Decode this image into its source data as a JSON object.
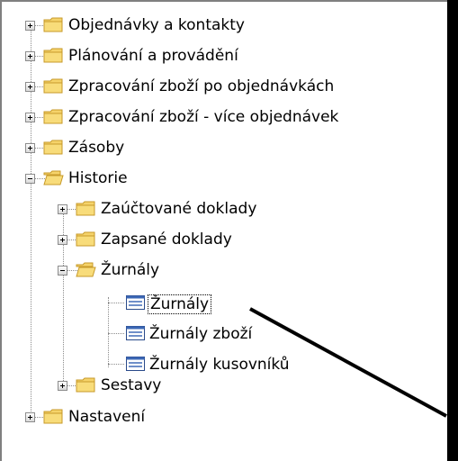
{
  "tree": {
    "nodes": [
      {
        "id": "objednavky",
        "label": "Objednávky a kontakty",
        "icon": "folder-closed-icon",
        "expander": "plus"
      },
      {
        "id": "planovani",
        "label": "Plánování a provádění",
        "icon": "folder-closed-icon",
        "expander": "plus"
      },
      {
        "id": "zpracovani-po",
        "label": "Zpracování zboží po objednávkách",
        "icon": "folder-closed-icon",
        "expander": "plus"
      },
      {
        "id": "zpracovani-vice",
        "label": "Zpracování zboží - více objednávek",
        "icon": "folder-closed-icon",
        "expander": "plus"
      },
      {
        "id": "zasoby",
        "label": "Zásoby",
        "icon": "folder-closed-icon",
        "expander": "plus"
      },
      {
        "id": "historie",
        "label": "Historie",
        "icon": "folder-open-icon",
        "expander": "minus"
      },
      {
        "id": "zauctovane",
        "label": "Zaúčtované doklady",
        "icon": "folder-closed-icon",
        "expander": "plus"
      },
      {
        "id": "zapsane",
        "label": "Zapsané doklady",
        "icon": "folder-closed-icon",
        "expander": "plus"
      },
      {
        "id": "zurnaly-folder",
        "label": "Žurnály",
        "icon": "folder-open-icon",
        "expander": "minus"
      },
      {
        "id": "zurnaly",
        "label": "Žurnály",
        "icon": "form-icon",
        "selected": true
      },
      {
        "id": "zurnaly-zbozi",
        "label": "Žurnály zboží",
        "icon": "form-icon"
      },
      {
        "id": "zurnaly-kusovniku",
        "label": "Žurnály kusovníků",
        "icon": "form-icon"
      },
      {
        "id": "sestavy",
        "label": "Sestavy",
        "icon": "folder-closed-icon",
        "expander": "plus"
      },
      {
        "id": "nastaveni",
        "label": "Nastavení",
        "icon": "folder-closed-icon",
        "expander": "plus"
      }
    ]
  },
  "colors": {
    "folder": "#f5d36a",
    "folder_edge": "#c79a2a",
    "pointer": "#000000"
  }
}
